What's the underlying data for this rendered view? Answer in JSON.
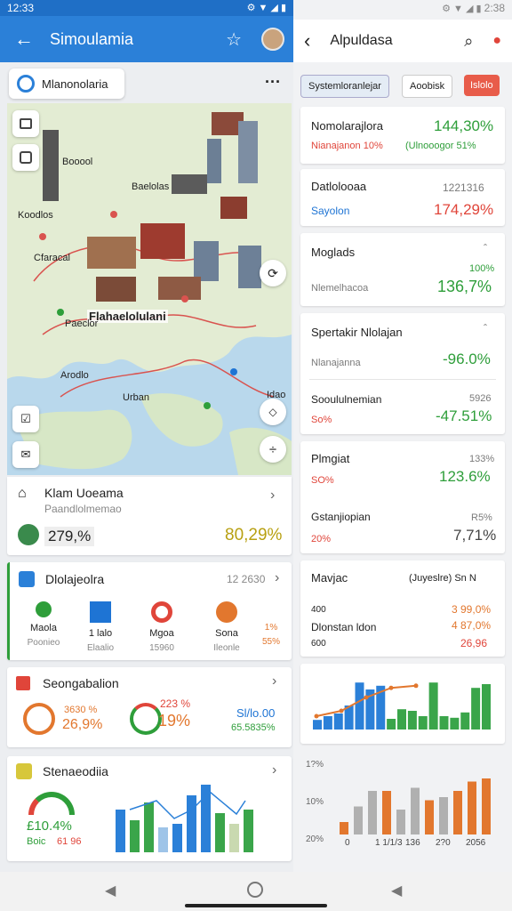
{
  "status_left": {
    "time": "12:33"
  },
  "status_right": {
    "time": "2:38"
  },
  "left": {
    "appbar": {
      "title": "Simoulamia",
      "back_icon": "arrow-left-icon",
      "star_icon": "star-icon",
      "avatar": "avatar"
    },
    "search_chip": {
      "label": "Mlanonolaria",
      "more": "···"
    },
    "map": {
      "center_label": "Flahaelolulani",
      "label_boocool": "Booool",
      "label_baelolas": "Baelolas",
      "label_koodlos": "Koodlos",
      "label_cfaracal": "Cfaracal",
      "label_paeclor": "Paeclor",
      "label_arodlo": "Arodlo",
      "label_urban": "Urban",
      "label_idao": "Idao"
    },
    "location_card": {
      "title": "Klam Uoeama",
      "subtitle": "Paandlolmemao",
      "left_value": "279,%",
      "right_value": "80,29%"
    },
    "apps_card": {
      "title": "Dlolajeolra",
      "meta": "12 2630",
      "items": [
        {
          "name": "Maola",
          "sub": "Poonieo"
        },
        {
          "name": "1 lalo",
          "sub": "Elaalio"
        },
        {
          "name": "Mgoa",
          "sub": "15960"
        },
        {
          "name": "Sona",
          "sub": "Ileonle"
        },
        {
          "name": "1%",
          "sub": "55%"
        }
      ]
    },
    "stats_card": {
      "title": "Seongabalion",
      "v1_top": "3630 %",
      "v1": "26,9%",
      "v2_top": "223 %",
      "v2": "19%",
      "v3": "Sl/lo.00",
      "v3_sub": "65.5835%"
    },
    "bottom_card": {
      "title": "Stenaeodiia",
      "gauge_value": "£10.4%",
      "gauge_left": "Boic",
      "gauge_right": "61 96"
    }
  },
  "right": {
    "header": {
      "title": "Alpuldasa"
    },
    "filters": {
      "chip1": "Systemloranlejar",
      "chip2": "Aoobisk",
      "chip3": "Islolo"
    },
    "rows": [
      {
        "title": "Nomolarajlora",
        "value": "144,30%",
        "sub": "Nianajanon 10%",
        "sub_value": "(Ulnooogor 51%"
      },
      {
        "title": "Datlolooaa",
        "value": "1221316",
        "sub": "Sayolon",
        "sub_value": "174,29%"
      },
      {
        "title": "Moglads",
        "value": "100%",
        "sub": "Nlemelhacoa",
        "sub_value": "136,7%"
      },
      {
        "title": "Spertakir Nlolajan",
        "value": "",
        "sub": "Nlanajanna",
        "sub_value": "-96.0%"
      },
      {
        "title": "Sooululnemian",
        "value": "5926",
        "sub": "So%",
        "sub_value": "-47.51%"
      },
      {
        "title": "Plmgiat",
        "value": "133%",
        "sub": "SO%",
        "sub_value": "123.6%"
      },
      {
        "title": "Gstanjiopian",
        "value": "R5%",
        "sub": "20%",
        "sub_value": "7,71%"
      }
    ],
    "summary": {
      "title": "Mavjac",
      "meta": "(Juyeslre) Sn N",
      "r1_left": "400",
      "r1_right": "3 99,0%",
      "r2_left": "Dlonstan ldon",
      "r2_right": "4 87,0%",
      "r3_left": "600",
      "r3_right": "26,96"
    }
  },
  "chart_data": [
    {
      "type": "bar",
      "title": "",
      "values": [
        18,
        25,
        30,
        45,
        88,
        75,
        82,
        20,
        38,
        35,
        25,
        88,
        25,
        22,
        32,
        78,
        85
      ],
      "line": [
        25,
        35,
        60,
        78,
        82
      ]
    },
    {
      "type": "bar",
      "ylabel": "",
      "yticks": [
        "1?%",
        "10%",
        "20%"
      ],
      "xticks": [
        "0",
        "1 1/1/3",
        "136",
        "2?0",
        "2056"
      ],
      "values": [
        20,
        45,
        70,
        70,
        40,
        75,
        55,
        60,
        70,
        85,
        90
      ],
      "colors": [
        "#e2772e",
        "#b0b0b0",
        "#b0b0b0",
        "#e2772e",
        "#b0b0b0",
        "#b0b0b0",
        "#e2772e",
        "#b0b0b0",
        "#e2772e",
        "#e2772e",
        "#e2772e"
      ]
    }
  ],
  "colors": {
    "appbar": "#2b80d8",
    "green": "#2e9e3a",
    "red": "#e0453a",
    "orange": "#e2772e"
  }
}
